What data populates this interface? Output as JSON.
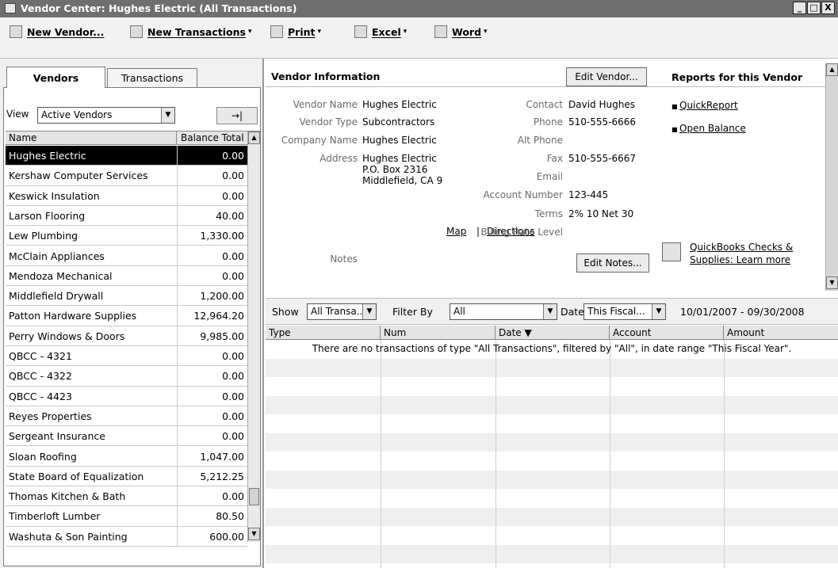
{
  "window": {
    "title": "Vendor Center: Hughes Electric (All Transactions)",
    "minimize": "_",
    "maximize": "□",
    "close": "X"
  },
  "toolbar": {
    "new_vendor": "New Vendor...",
    "new_transactions": "New Transactions",
    "print": "Print",
    "excel": "Excel",
    "word": "Word",
    "dropdown_arrow": "▾"
  },
  "left": {
    "tabs": [
      "Vendors",
      "Transactions"
    ],
    "view_label": "View",
    "view_value": "Active Vendors",
    "collapse_glyph": "→|",
    "columns": [
      "Name",
      "Balance Total"
    ],
    "vendors": [
      {
        "name": "Hughes Electric",
        "balance": "0.00"
      },
      {
        "name": "Kershaw Computer Services",
        "balance": "0.00"
      },
      {
        "name": "Keswick Insulation",
        "balance": "0.00"
      },
      {
        "name": "Larson Flooring",
        "balance": "40.00"
      },
      {
        "name": "Lew Plumbing",
        "balance": "1,330.00"
      },
      {
        "name": "McClain Appliances",
        "balance": "0.00"
      },
      {
        "name": "Mendoza Mechanical",
        "balance": "0.00"
      },
      {
        "name": "Middlefield Drywall",
        "balance": "1,200.00"
      },
      {
        "name": "Patton Hardware Supplies",
        "balance": "12,964.20"
      },
      {
        "name": "Perry Windows & Doors",
        "balance": "9,985.00"
      },
      {
        "name": "QBCC - 4321",
        "balance": "0.00"
      },
      {
        "name": "QBCC - 4322",
        "balance": "0.00"
      },
      {
        "name": "QBCC - 4423",
        "balance": "0.00"
      },
      {
        "name": "Reyes Properties",
        "balance": "0.00"
      },
      {
        "name": "Sergeant Insurance",
        "balance": "0.00"
      },
      {
        "name": "Sloan Roofing",
        "balance": "1,047.00"
      },
      {
        "name": "State Board of Equalization",
        "balance": "5,212.25"
      },
      {
        "name": "Thomas Kitchen & Bath",
        "balance": "0.00"
      },
      {
        "name": "Timberloft Lumber",
        "balance": "80.50"
      },
      {
        "name": "Washuta & Son Painting",
        "balance": "600.00"
      }
    ]
  },
  "info": {
    "header": "Vendor Information",
    "edit_vendor": "Edit Vendor...",
    "reports_header": "Reports for this Vendor",
    "reports": [
      "QuickReport",
      "Open Balance"
    ],
    "labels": {
      "vendor_name": "Vendor Name",
      "vendor_type": "Vendor Type",
      "company_name": "Company Name",
      "address": "Address",
      "contact": "Contact",
      "phone": "Phone",
      "alt_phone": "Alt Phone",
      "fax": "Fax",
      "email": "Email",
      "account_number": "Account Number",
      "terms": "Terms",
      "billing_rate": "Billing Rate Level",
      "notes": "Notes"
    },
    "values": {
      "vendor_name": "Hughes Electric",
      "vendor_type": "Subcontractors",
      "company_name": "Hughes Electric",
      "address_1": "Hughes Electric",
      "address_2": "P.O. Box 2316",
      "address_3": "Middlefield, CA 9",
      "contact": "David Hughes",
      "phone": "510-555-6666",
      "fax": "510-555-6667",
      "account_number": "123-445",
      "terms": "2% 10 Net 30"
    },
    "map": "Map",
    "link_sep": "|",
    "directions": "Directions",
    "edit_notes": "Edit Notes...",
    "promo_line1": "QuickBooks Checks &",
    "promo_line2": "Supplies: Learn more"
  },
  "filter": {
    "show_label": "Show",
    "show_value": "All Transa...",
    "filter_label": "Filter By",
    "filter_value": "All",
    "date_label": "Date",
    "date_value": "This Fiscal...",
    "date_range": "10/01/2007 - 09/30/2008"
  },
  "transactions": {
    "columns": [
      "Type",
      "Num",
      "Date ▼",
      "Account",
      "Amount"
    ],
    "empty_message": "There are no transactions of type \"All Transactions\", filtered by \"All\", in date range \"This Fiscal Year\"."
  }
}
